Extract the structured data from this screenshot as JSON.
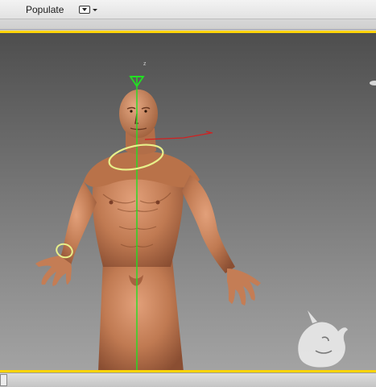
{
  "ribbon": {
    "tab_label": "Populate",
    "dropdown_icon": "dropdown-icon"
  },
  "viewport": {
    "border_color": "#ffd400",
    "background": "shaded-gray-gradient",
    "subject": "character-mesh",
    "gizmo_colors": {
      "y_axis": "#22e022",
      "x_axis": "#d22020",
      "selection_ring": "#e8f08a"
    },
    "logo_icon": "unicorn-logo-icon"
  },
  "status": {
    "cell_icon": "status-cell"
  }
}
